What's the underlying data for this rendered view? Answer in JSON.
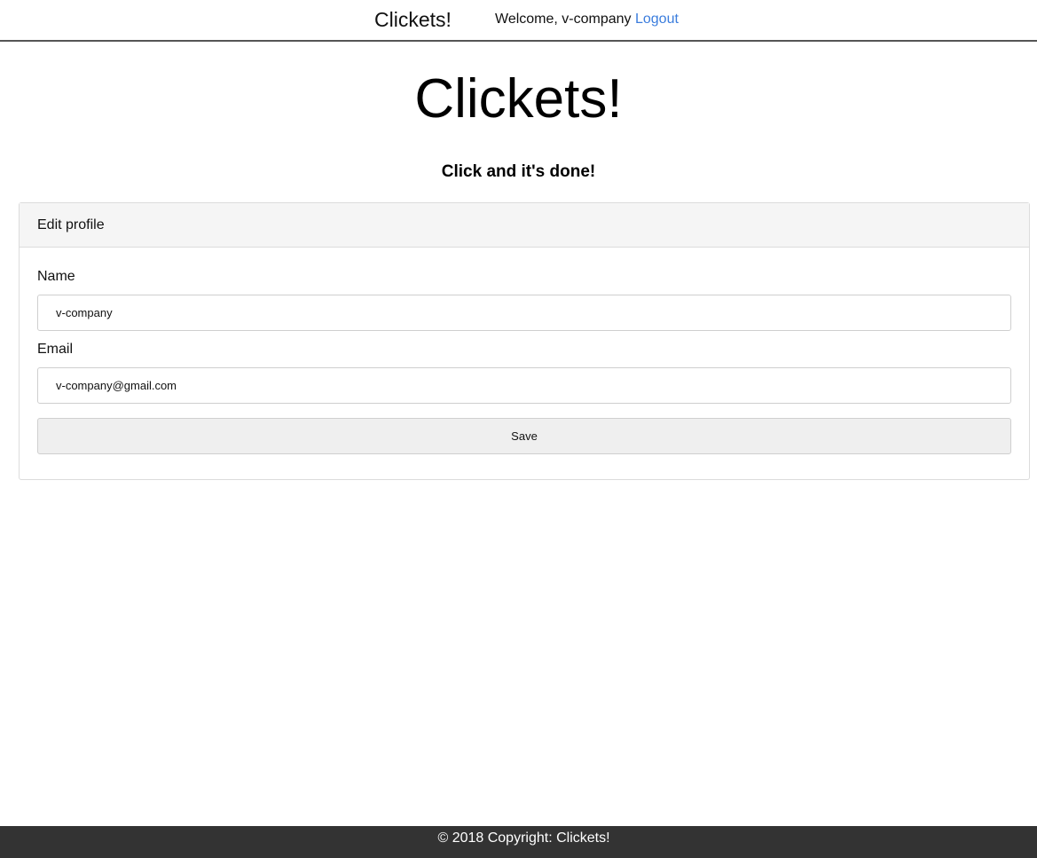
{
  "navbar": {
    "brand": "Clickets!",
    "welcome_text": "Welcome, v-company",
    "logout_label": "Logout"
  },
  "hero": {
    "title": "Clickets!",
    "tagline": "Click and it's done!"
  },
  "profile_card": {
    "header": "Edit profile",
    "name_label": "Name",
    "name_value": "v-company",
    "email_label": "Email",
    "email_value": "v-company@gmail.com",
    "save_label": "Save"
  },
  "footer": {
    "copyright": "© 2018 Copyright: Clickets!"
  },
  "colors": {
    "link": "#3b7ddd",
    "footer_bg": "#333333",
    "card_header_bg": "#f5f5f5",
    "button_bg": "#efefef"
  }
}
